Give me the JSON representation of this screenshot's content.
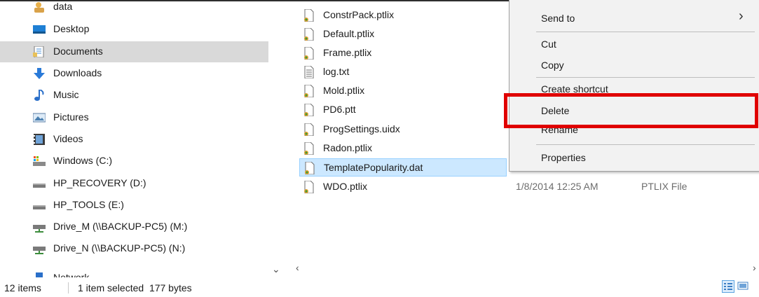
{
  "nav": {
    "items": [
      {
        "label": "data",
        "icon": "user-folder-icon"
      },
      {
        "label": "Desktop",
        "icon": "desktop-icon"
      },
      {
        "label": "Documents",
        "icon": "documents-icon"
      },
      {
        "label": "Downloads",
        "icon": "download-arrow-icon"
      },
      {
        "label": "Music",
        "icon": "music-note-icon"
      },
      {
        "label": "Pictures",
        "icon": "pictures-icon"
      },
      {
        "label": "Videos",
        "icon": "videos-icon"
      },
      {
        "label": "Windows (C:)",
        "icon": "windows-drive-icon"
      },
      {
        "label": "HP_RECOVERY (D:)",
        "icon": "drive-icon"
      },
      {
        "label": "HP_TOOLS (E:)",
        "icon": "drive-icon"
      },
      {
        "label": "Drive_M (\\\\BACKUP-PC5) (M:)",
        "icon": "network-drive-icon"
      },
      {
        "label": "Drive_N (\\\\BACKUP-PC5) (N:)",
        "icon": "network-drive-icon"
      },
      {
        "label": "Network",
        "icon": "network-icon"
      }
    ],
    "selected": "Documents"
  },
  "files": {
    "rows": [
      {
        "name": "ConstrPack.ptlix",
        "icon": "ptlix-file-icon"
      },
      {
        "name": "Default.ptlix",
        "icon": "ptlix-file-icon"
      },
      {
        "name": "Frame.ptlix",
        "icon": "ptlix-file-icon"
      },
      {
        "name": "log.txt",
        "icon": "text-file-icon"
      },
      {
        "name": "Mold.ptlix",
        "icon": "ptlix-file-icon"
      },
      {
        "name": "PD6.ptt",
        "icon": "ptt-file-icon"
      },
      {
        "name": "ProgSettings.uidx",
        "icon": "uidx-file-icon"
      },
      {
        "name": "Radon.ptlix",
        "icon": "ptlix-file-icon"
      },
      {
        "name": "TemplatePopularity.dat",
        "icon": "dat-file-icon"
      },
      {
        "name": "WDO.ptlix",
        "icon": "ptlix-file-icon",
        "date": "1/8/2014 12:25 AM",
        "type": "PTLIX File"
      }
    ],
    "selected": "TemplatePopularity.dat"
  },
  "context_menu": {
    "send_to": "Send to",
    "cut": "Cut",
    "copy": "Copy",
    "create_shortcut": "Create shortcut",
    "delete": "Delete",
    "rename": "Rename",
    "properties": "Properties",
    "highlighted": "Delete",
    "highlight_color": "#e00000"
  },
  "status": {
    "item_count": "12 items",
    "selection": "1 item selected  177 bytes"
  },
  "colors": {
    "selection_bg": "#cce8ff",
    "nav_selected_bg": "#d9d9d9",
    "menu_bg": "#f2f2f2"
  }
}
